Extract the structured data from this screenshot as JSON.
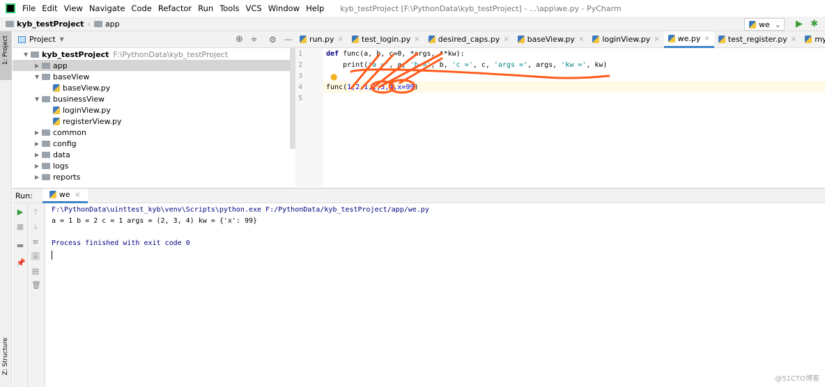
{
  "menubar": {
    "items": [
      "File",
      "Edit",
      "View",
      "Navigate",
      "Code",
      "Refactor",
      "Run",
      "Tools",
      "VCS",
      "Window",
      "Help"
    ],
    "window_title": "kyb_testProject [F:\\PythonData\\kyb_testProject] - ...\\app\\we.py - PyCharm"
  },
  "breadcrumb": {
    "project": "kyb_testProject",
    "folder": "app",
    "run_config": "we"
  },
  "stripe": {
    "project_label": "1: Project",
    "structure_label": "Z: Structure"
  },
  "project_panel": {
    "title": "Project",
    "tree": [
      {
        "label": "kyb_testProject",
        "hint": "F:\\PythonData\\kyb_testProject",
        "type": "folder",
        "depth": 0,
        "open": true
      },
      {
        "label": "app",
        "type": "folder",
        "depth": 1,
        "selected": true
      },
      {
        "label": "baseView",
        "type": "folder",
        "depth": 1,
        "open": true
      },
      {
        "label": "baseView.py",
        "type": "py",
        "depth": 2
      },
      {
        "label": "businessView",
        "type": "folder",
        "depth": 1,
        "open": true
      },
      {
        "label": "loginView.py",
        "type": "py",
        "depth": 2
      },
      {
        "label": "registerView.py",
        "type": "py",
        "depth": 2
      },
      {
        "label": "common",
        "type": "folder",
        "depth": 1
      },
      {
        "label": "config",
        "type": "folder",
        "depth": 1
      },
      {
        "label": "data",
        "type": "folder",
        "depth": 1
      },
      {
        "label": "logs",
        "type": "folder",
        "depth": 1
      },
      {
        "label": "reports",
        "type": "folder",
        "depth": 1
      }
    ]
  },
  "tabs": [
    {
      "label": "run.py"
    },
    {
      "label": "test_login.py"
    },
    {
      "label": "desired_caps.py"
    },
    {
      "label": "baseView.py"
    },
    {
      "label": "loginView.py"
    },
    {
      "label": "we.py",
      "active": true
    },
    {
      "label": "test_register.py"
    },
    {
      "label": "myunit.py"
    }
  ],
  "editor": {
    "line_numbers": [
      "1",
      "2",
      "3",
      "4",
      "5"
    ],
    "lines": {
      "l1": {
        "kw": "def",
        "rest": " func(a, b, c=0, *args, **kw):"
      },
      "l2": {
        "a": "    print(",
        "s1": "'a ='",
        "b": ", a, ",
        "s2": "'b ='",
        "c": ", b, ",
        "s3": "'c ='",
        "d": ", c, ",
        "s4": "'args ='",
        "e": ", args, ",
        "s5": "'kw ='",
        "f": ", kw)"
      },
      "l4": {
        "a": "func(",
        "n": "1,2,1,2,3,4,x=99",
        "b": ")"
      }
    },
    "annotation_color": "#ff5a1a"
  },
  "run": {
    "label": "Run:",
    "tab": "we",
    "output": [
      "F:\\PythonData\\uinttest_kyb\\venv\\Scripts\\python.exe F:/PythonData/kyb_testProject/app/we.py",
      "a = 1 b = 2 c = 1 args = (2, 3, 4) kw = {'x': 99}",
      "",
      "Process finished with exit code 0"
    ]
  },
  "watermark": "@51CTO博客"
}
